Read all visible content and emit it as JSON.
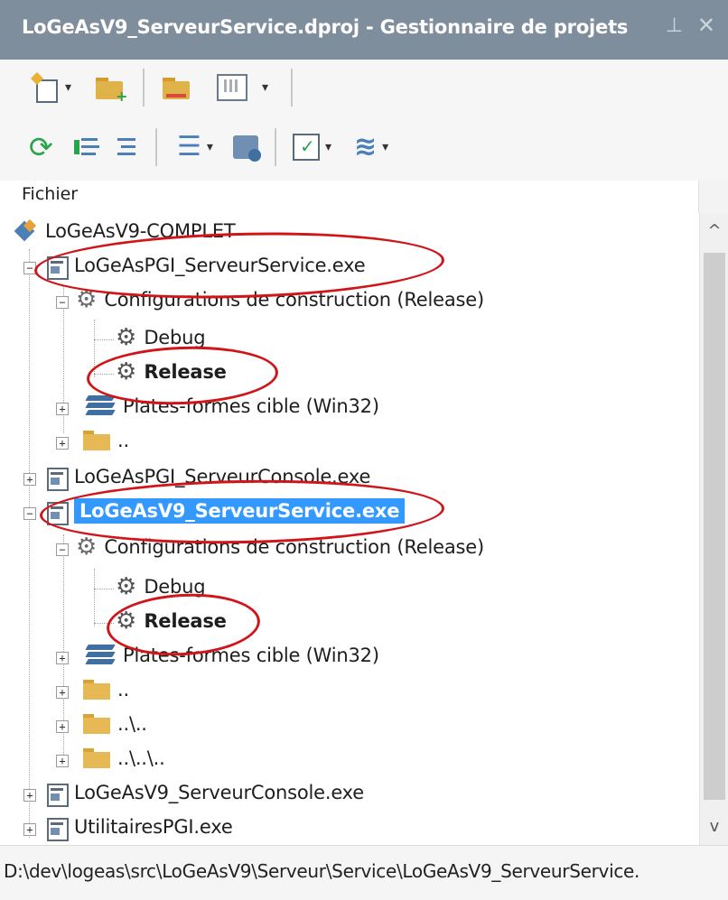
{
  "window": {
    "title": "LoGeAsV9_ServeurService.dproj - Gestionnaire de projets",
    "pin_icon": "pin-icon",
    "close_icon": "close-icon"
  },
  "toolbar1": {
    "buttons": [
      "new-project-icon",
      "add-existing-icon",
      "remove-folder-icon",
      "layout-icon"
    ]
  },
  "toolbar2": {
    "buttons": [
      "refresh-icon",
      "expand-icon",
      "collapse-icon",
      "build-order-icon",
      "show-targets-icon",
      "build-check-icon",
      "build-all-icon"
    ]
  },
  "column_header": "Fichier",
  "tree": [
    {
      "label": "LoGeAsV9-COMPLET"
    },
    {
      "label": "LoGeAsPGI_ServeurService.exe"
    },
    {
      "label": "Configurations de construction (Release)"
    },
    {
      "label": "Debug"
    },
    {
      "label": "Release"
    },
    {
      "label": "Plates-formes cible (Win32)"
    },
    {
      "label": ".."
    },
    {
      "label": "LoGeAsPGI_ServeurConsole.exe"
    },
    {
      "label": "LoGeAsV9_ServeurService.exe"
    },
    {
      "label": "Configurations de construction (Release)"
    },
    {
      "label": "Debug"
    },
    {
      "label": "Release"
    },
    {
      "label": "Plates-formes cible (Win32)"
    },
    {
      "label": ".."
    },
    {
      "label": "..\\.."
    },
    {
      "label": "..\\..\\.."
    },
    {
      "label": "LoGeAsV9_ServeurConsole.exe"
    },
    {
      "label": "UtilitairesPGI.exe"
    }
  ],
  "expander": {
    "plus": "+",
    "minus": "−"
  },
  "status": {
    "path": "D:\\dev\\logeas\\src\\LoGeAsV9\\Serveur\\Service\\LoGeAsV9_ServeurService."
  },
  "colors": {
    "title_bg": "#7f8e9c",
    "selection": "#3399ff",
    "annotation_red": "#d01418"
  }
}
